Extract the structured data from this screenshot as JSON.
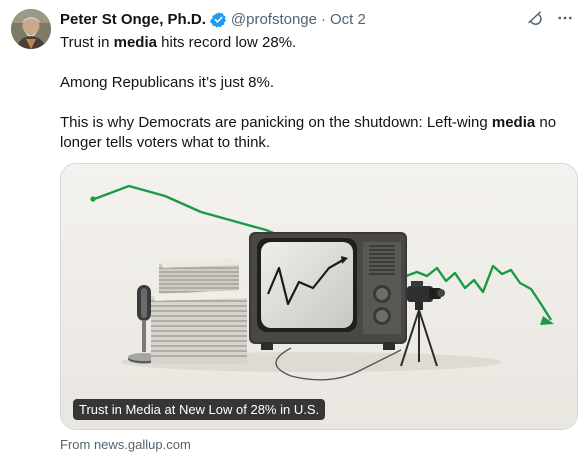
{
  "author": {
    "name": "Peter St Onge, Ph.D.",
    "handle": "@profstonge",
    "date": "Oct 2",
    "verified": true
  },
  "tweet": {
    "line1": {
      "pre": "Trust in ",
      "bold": "media",
      "post": " hits record low 28%."
    },
    "line2": "Among Republicans it’s just 8%.",
    "line3": {
      "pre": "This is why Democrats are panicking on the shutdown: Left-wing ",
      "bold": "media",
      "post": " no longer tells voters what to think."
    }
  },
  "media": {
    "caption": "Trust in Media at New Low of 28% in U.S.",
    "source": "From news.gallup.com"
  },
  "icons": [
    "avatar",
    "verified-badge-icon",
    "grok-icon",
    "more-icon"
  ],
  "colors": {
    "accent": "#1d9bf0",
    "trend_line": "#1a9a44",
    "muted": "#536471"
  }
}
